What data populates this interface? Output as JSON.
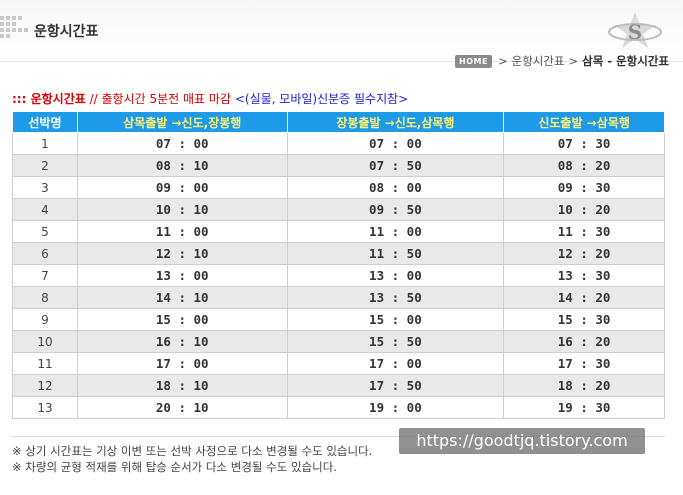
{
  "header": {
    "title": "운항시간표"
  },
  "breadcrumb": {
    "home": "HOME",
    "items": [
      "운항시간표",
      "삼목 - 운항시간표"
    ]
  },
  "notice": {
    "part1": "::: 운항시간표",
    "part2": "// 출항시간 5분전 매표 마감",
    "part3": "<(실물, 모바일)신분증 필수지참>"
  },
  "table": {
    "headers": [
      "선박명",
      "삼목출발 →신도,장봉행",
      "장봉출발 →신도,삼목행",
      "신도출발 →삼목행"
    ],
    "rows": [
      [
        "1",
        "07 : 00",
        "07 : 00",
        "07 : 30"
      ],
      [
        "2",
        "08 : 10",
        "07 : 50",
        "08 : 20"
      ],
      [
        "3",
        "09 : 00",
        "08 : 00",
        "09 : 30"
      ],
      [
        "4",
        "10 : 10",
        "09 : 50",
        "10 : 20"
      ],
      [
        "5",
        "11 : 00",
        "11 : 00",
        "11 : 30"
      ],
      [
        "6",
        "12 : 10",
        "11 : 50",
        "12 : 20"
      ],
      [
        "7",
        "13 : 00",
        "13 : 00",
        "13 : 30"
      ],
      [
        "8",
        "14 : 10",
        "13 : 50",
        "14 : 20"
      ],
      [
        "9",
        "15 : 00",
        "15 : 00",
        "15 : 30"
      ],
      [
        "10",
        "16 : 10",
        "15 : 50",
        "16 : 20"
      ],
      [
        "11",
        "17 : 00",
        "17 : 00",
        "17 : 30"
      ],
      [
        "12",
        "18 : 10",
        "17 : 50",
        "18 : 20"
      ],
      [
        "13",
        "20 : 10",
        "19 : 00",
        "19 : 30"
      ]
    ]
  },
  "footer": {
    "line1": "※ 상기 시간표는 기상 이변 또는 선박 사정으로 다소 변경될 수도 있습니다.",
    "line2": "※ 차량의 균형 적재를 위해 탑승 순서가 다소 변경될 수도 있습니다."
  },
  "watermark": "https://goodtjq.tistory.com",
  "colors": {
    "header_bg": "#1e9be8",
    "header_highlight": "#fff176",
    "notice_red": "#d60000",
    "notice_blue": "#2222cc",
    "stripe": "#e9e9e9"
  },
  "icons": {
    "logo": "s-star-logo-icon",
    "dots": "dots-grid-icon"
  }
}
